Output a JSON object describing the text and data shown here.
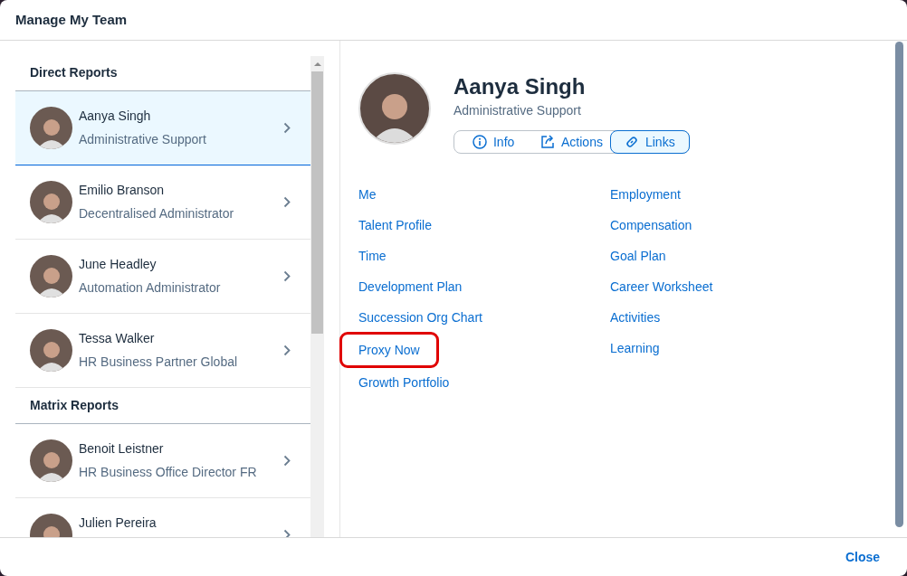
{
  "dialog": {
    "title": "Manage My Team"
  },
  "sections": [
    {
      "heading": "Direct Reports",
      "people": [
        {
          "name": "Aanya Singh",
          "role": "Administrative Support",
          "selected": true
        },
        {
          "name": "Emilio Branson",
          "role": "Decentralised Administrator",
          "selected": false
        },
        {
          "name": "June Headley",
          "role": "Automation Administrator",
          "selected": false
        },
        {
          "name": "Tessa Walker",
          "role": "HR Business Partner Global",
          "selected": false
        }
      ]
    },
    {
      "heading": "Matrix Reports",
      "people": [
        {
          "name": "Benoit Leistner",
          "role": "HR Business Office Director FR",
          "selected": false
        },
        {
          "name": "Julien Pereira",
          "selected": false
        }
      ]
    }
  ],
  "profile": {
    "name": "Aanya Singh",
    "role": "Administrative Support"
  },
  "tabs": [
    {
      "label": "Info",
      "selected": false
    },
    {
      "label": "Actions",
      "selected": false
    },
    {
      "label": "Links",
      "selected": true
    }
  ],
  "link_columns": [
    [
      {
        "label": "Me",
        "highlighted": false
      },
      {
        "label": "Talent Profile",
        "highlighted": false
      },
      {
        "label": "Time",
        "highlighted": false
      },
      {
        "label": "Development Plan",
        "highlighted": false
      },
      {
        "label": "Succession Org Chart",
        "highlighted": false
      },
      {
        "label": "Proxy Now",
        "highlighted": true
      },
      {
        "label": "Growth Portfolio",
        "highlighted": false
      }
    ],
    [
      {
        "label": "Employment",
        "highlighted": false
      },
      {
        "label": "Compensation",
        "highlighted": false
      },
      {
        "label": "Goal Plan",
        "highlighted": false
      },
      {
        "label": "Career Worksheet",
        "highlighted": false
      },
      {
        "label": "Activities",
        "highlighted": false
      },
      {
        "label": "Learning",
        "highlighted": false
      }
    ]
  ],
  "footer": {
    "close": "Close"
  }
}
